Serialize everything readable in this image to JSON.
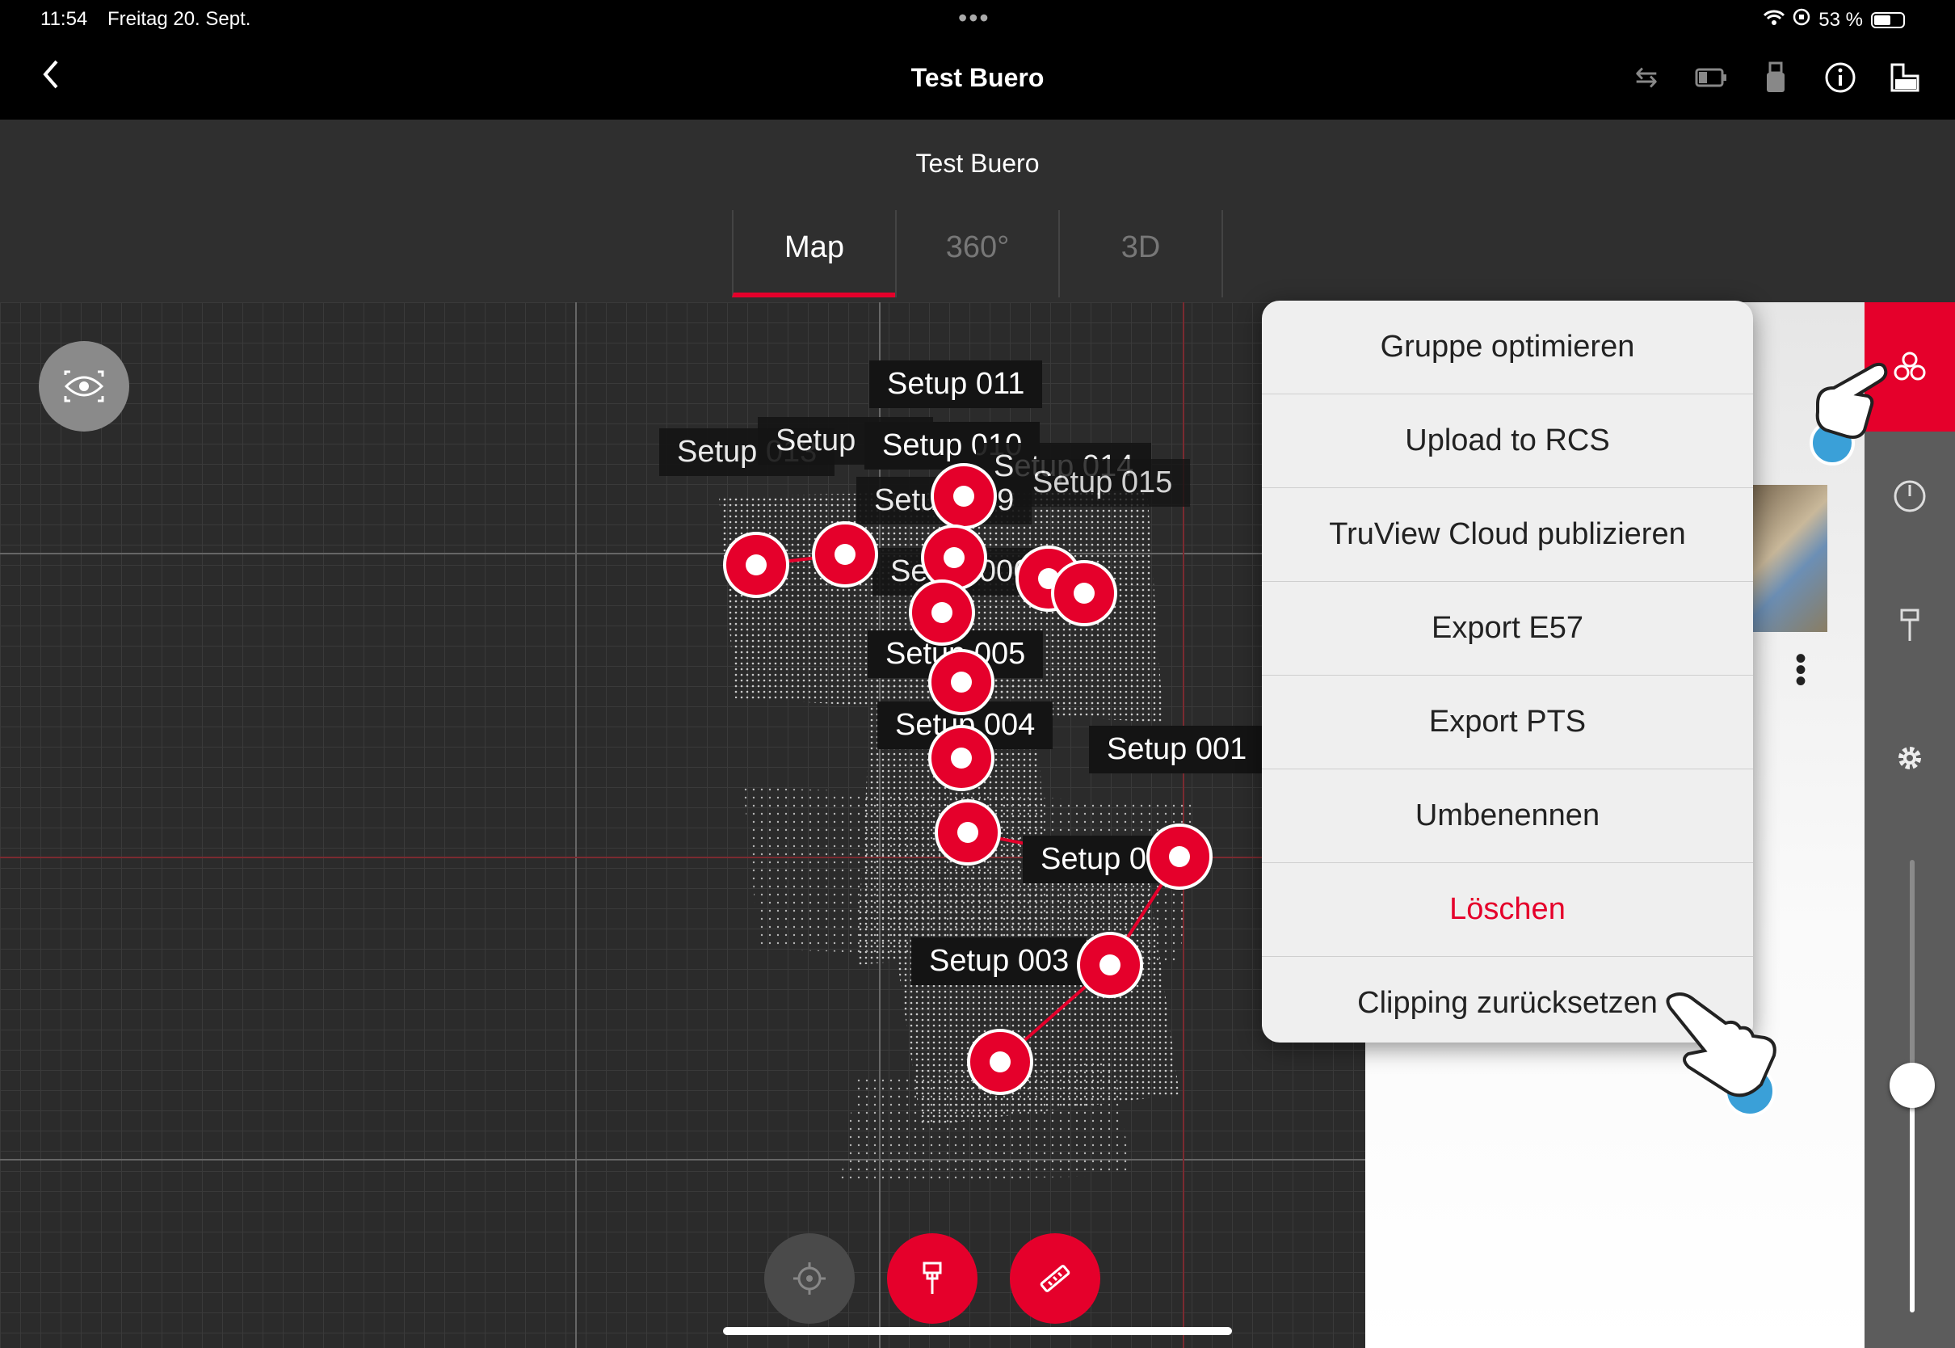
{
  "status": {
    "time": "11:54",
    "date": "Freitag 20. Sept.",
    "battery": "53 %",
    "battery_level": 0.53
  },
  "nav": {
    "title": "Test Buero",
    "back_icon": "chevron-left-icon",
    "icons": [
      "swap-icon",
      "battery-device-icon",
      "usb-device-icon",
      "info-icon",
      "layout-icon"
    ]
  },
  "header": {
    "subtitle": "Test Buero",
    "tabs": [
      "Map",
      "360°",
      "3D"
    ],
    "active_tab": "Map"
  },
  "map": {
    "labels": [
      "Setup 011",
      "Setup 013",
      "Setup 012",
      "Setup 010",
      "Setup 014",
      "Setup 015",
      "Setup 009",
      "Setup 006",
      "Setup 005",
      "Setup 004",
      "Setup 001",
      "Setup 002",
      "Setup 003"
    ],
    "fabs": [
      "locate-icon",
      "pin-icon",
      "measure-icon"
    ]
  },
  "menu": {
    "items": [
      "Gruppe optimieren",
      "Upload to RCS",
      "TruView Cloud publizieren",
      "Export E57",
      "Export PTS",
      "Umbenennen",
      "Löschen",
      "Clipping zurücksetzen"
    ]
  },
  "sidebar": {
    "icons": [
      "group-icon",
      "compass-icon",
      "pin-icon",
      "gear-icon"
    ],
    "slider_value": 0.5
  },
  "colors": {
    "accent": "#e5002b",
    "map_bg": "#2b2b2b",
    "menu_bg": "#efefef"
  }
}
